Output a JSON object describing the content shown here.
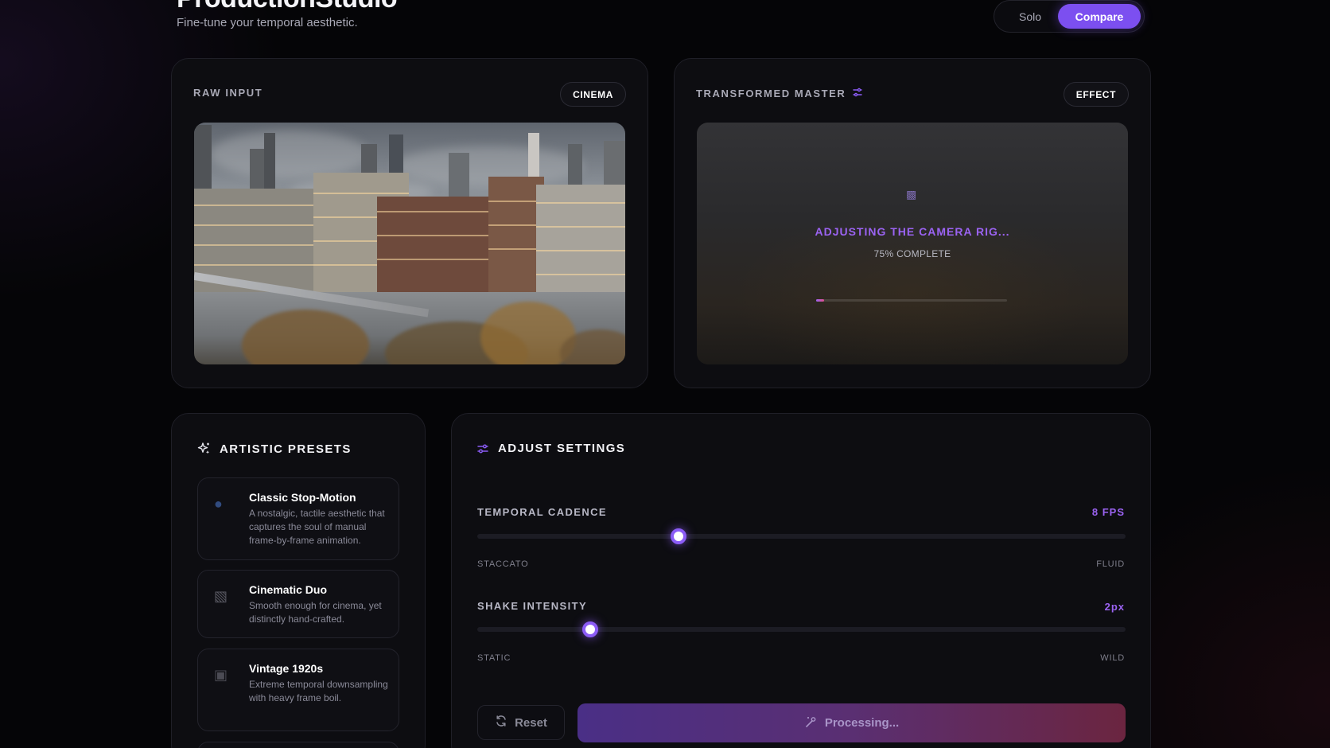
{
  "header": {
    "title": "ProductionStudio",
    "subtitle": "Fine-tune your temporal aesthetic.",
    "view_toggle": {
      "solo": "Solo",
      "compare": "Compare",
      "active": "Compare"
    }
  },
  "raw_panel": {
    "label": "RAW INPUT",
    "chip": "CINEMA"
  },
  "master_panel": {
    "label": "TRANSFORMED MASTER",
    "chip": "EFFECT",
    "processing_title": "ADJUSTING THE CAMERA RIG...",
    "processing_status": "75% COMPLETE",
    "progress_bar_fill": 0.04
  },
  "presets": {
    "title": "ARTISTIC PRESETS",
    "items": [
      {
        "icon": "puppet-icon",
        "name": "Classic Stop-Motion",
        "description": "A nostalgic, tactile aesthetic that captures the soul of manual frame-by-frame animation."
      },
      {
        "icon": "clapperboard-icon",
        "name": "Cinematic Duo",
        "description": "Smooth enough for cinema, yet distinctly hand-crafted."
      },
      {
        "icon": "film-camera-icon",
        "name": "Vintage 1920s",
        "description": "Extreme temporal downsampling with heavy frame boil."
      }
    ]
  },
  "settings": {
    "title": "ADJUST SETTINGS",
    "cadence": {
      "label": "TEMPORAL CADENCE",
      "value": "8 FPS",
      "fraction": 0.31,
      "min_label": "STACCATO",
      "max_label": "FLUID"
    },
    "shake": {
      "label": "SHAKE INTENSITY",
      "value": "2px",
      "fraction": 0.174,
      "min_label": "STATIC",
      "max_label": "WILD"
    },
    "reset_label": "Reset",
    "process_label": "Processing..."
  },
  "colors": {
    "accent": "#8b5cf6",
    "accent_pink": "#e04f8a",
    "background": "#050507"
  }
}
